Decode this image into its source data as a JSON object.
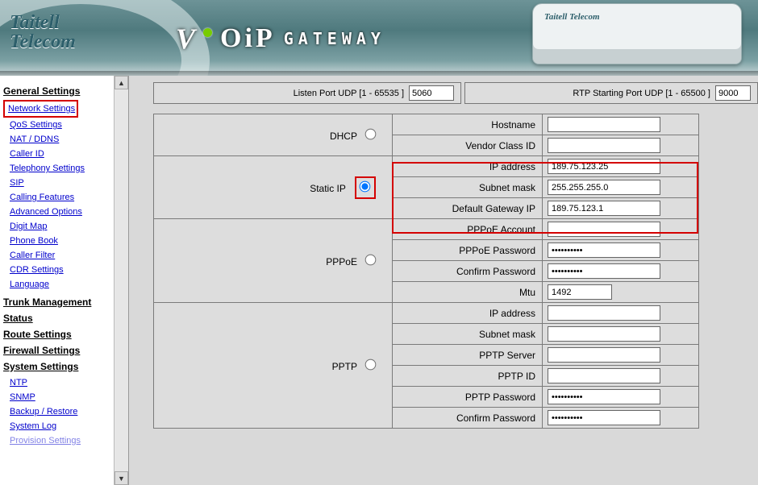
{
  "brand_line1": "Taitell",
  "brand_line2": "Telecom",
  "logo_word1": "OiP",
  "logo_word2": "GATEWAY",
  "device_label": "Taitell Telecom",
  "sidebar": {
    "categories": {
      "general": "General Settings",
      "trunk": "Trunk Management",
      "status": "Status",
      "route": "Route Settings",
      "firewall": "Firewall Settings",
      "system": "System Settings"
    },
    "general_links": [
      "Network Settings",
      "QoS Settings",
      "NAT / DDNS",
      "Caller ID",
      "Telephony Settings",
      "SIP",
      "Calling Features",
      "Advanced Options",
      "Digit Map",
      "Phone Book",
      "Caller Filter",
      "CDR Settings",
      "Language"
    ],
    "system_links": [
      "NTP",
      "SNMP",
      "Backup / Restore",
      "System Log",
      "Provision Settings"
    ]
  },
  "ports": {
    "listen_label": "Listen Port UDP [1 - 65535 ]",
    "listen_value": "5060",
    "rtp_label": "RTP Starting Port UDP [1 - 65500 ]",
    "rtp_value": "9000"
  },
  "groups": {
    "dhcp": {
      "label": "DHCP",
      "rows": [
        {
          "k": "hostname",
          "label": "Hostname",
          "value": ""
        },
        {
          "k": "vendor",
          "label": "Vendor Class ID",
          "value": ""
        }
      ]
    },
    "static": {
      "label": "Static IP",
      "rows": [
        {
          "k": "ip",
          "label": "IP address",
          "value": "189.75.123.25"
        },
        {
          "k": "mask",
          "label": "Subnet mask",
          "value": "255.255.255.0"
        },
        {
          "k": "gw",
          "label": "Default Gateway IP",
          "value": "189.75.123.1"
        }
      ]
    },
    "pppoe": {
      "label": "PPPoE",
      "rows": [
        {
          "k": "acct",
          "label": "PPPoE Account",
          "value": ""
        },
        {
          "k": "pass",
          "label": "PPPoE Password",
          "value": "••••••••••",
          "type": "password"
        },
        {
          "k": "conf",
          "label": "Confirm Password",
          "value": "••••••••••",
          "type": "password"
        },
        {
          "k": "mtu",
          "label": "Mtu",
          "value": "1492"
        }
      ]
    },
    "pptp": {
      "label": "PPTP",
      "rows": [
        {
          "k": "ip",
          "label": "IP address",
          "value": ""
        },
        {
          "k": "mask",
          "label": "Subnet mask",
          "value": ""
        },
        {
          "k": "server",
          "label": "PPTP Server",
          "value": ""
        },
        {
          "k": "id",
          "label": "PPTP ID",
          "value": ""
        },
        {
          "k": "pass",
          "label": "PPTP Password",
          "value": "••••••••••",
          "type": "password"
        },
        {
          "k": "conf",
          "label": "Confirm Password",
          "value": "••••••••••",
          "type": "password"
        }
      ]
    }
  },
  "selected_group": "static"
}
